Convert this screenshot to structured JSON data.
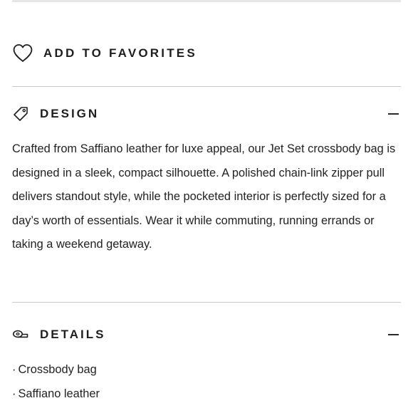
{
  "favorites": {
    "label": "ADD TO FAVORITES",
    "icon": "heart-icon"
  },
  "sections": [
    {
      "title": "DESIGN",
      "icon": "tag-icon",
      "state": "expanded",
      "toggle_icon": "minus-icon",
      "body": "Crafted from Saffiano leather for luxe appeal, our Jet Set crossbody bag is designed in a sleek, compact silhouette. A polished chain-link zipper pull delivers standout style, while the pocketed interior is perfectly sized for a day’s worth of essentials. Wear it while commuting, running errands or taking a weekend getaway."
    },
    {
      "title": "DETAILS",
      "icon": "measuring-tape-icon",
      "state": "expanded",
      "toggle_icon": "minus-icon",
      "bullet_char": "·",
      "items": [
        "Crossbody bag",
        "Saffiano leather"
      ]
    }
  ],
  "colors": {
    "text": "#1e1e1e",
    "divider": "#c9c9c9",
    "background": "#ffffff"
  }
}
